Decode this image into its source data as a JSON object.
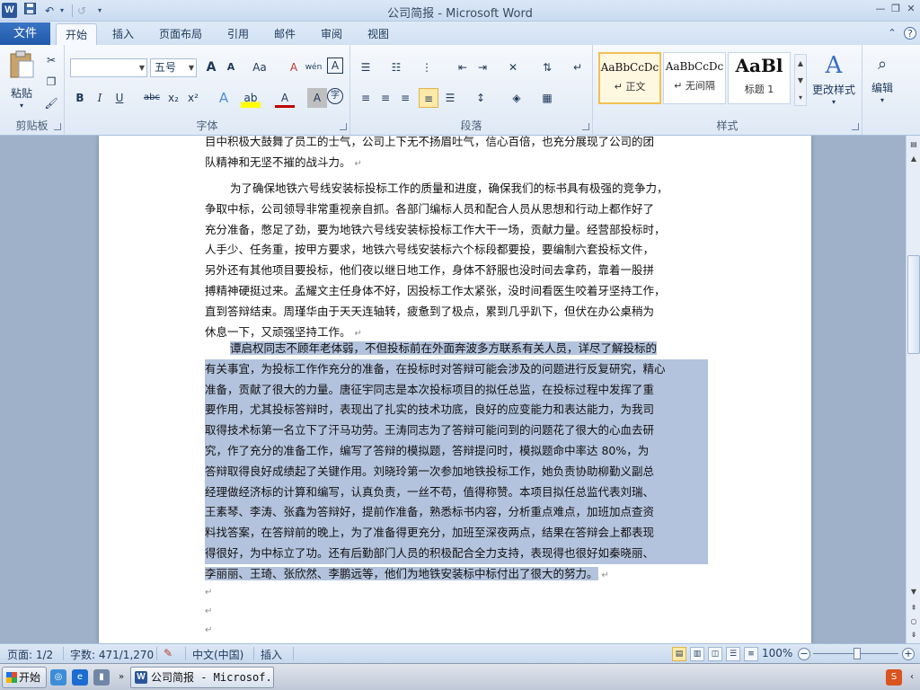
{
  "window": {
    "title": "公司简报 - Microsoft Word",
    "app_icon": "W"
  },
  "quick_access": {
    "items": [
      {
        "name": "save-icon",
        "glyph": "💾"
      },
      {
        "name": "undo-icon",
        "glyph": "↶"
      },
      {
        "name": "undo-dropdown-icon",
        "glyph": "▾"
      },
      {
        "name": "redo-icon",
        "glyph": "↺"
      },
      {
        "name": "customize-qa-icon",
        "glyph": "▾"
      }
    ]
  },
  "window_buttons": {
    "minimize": "—",
    "restore": "❐",
    "close": "✕"
  },
  "tabs": {
    "file": "文件",
    "items": [
      "开始",
      "插入",
      "页面布局",
      "引用",
      "邮件",
      "审阅",
      "视图"
    ],
    "active": "开始",
    "help_glyph": "?",
    "collapse_glyph": "⌃"
  },
  "ribbon": {
    "clipboard": {
      "label": "剪贴板",
      "paste": "粘贴",
      "paste_arrow": "▾"
    },
    "font": {
      "label": "字体",
      "font_name": "",
      "font_size": "五号",
      "bold": "B",
      "italic": "I",
      "underline": "U",
      "strike": "abc",
      "subscript": "x₂",
      "superscript": "x²",
      "grow": "A",
      "shrink": "A",
      "change_case": "Aa",
      "clear_format": "A",
      "phonetic": "wén",
      "char_border": "A",
      "text_effect": "A",
      "highlight": "ab",
      "font_color": "A",
      "char_shading": "A",
      "enclose": "字"
    },
    "paragraph": {
      "label": "段落"
    },
    "styles": {
      "label": "样式",
      "items": [
        {
          "sample": "AaBbCcDc",
          "name": "↵ 正文"
        },
        {
          "sample": "AaBbCcDc",
          "name": "↵ 无间隔"
        },
        {
          "sample": "AaBl",
          "name": "标题 1"
        }
      ],
      "change_styles": "更改样式"
    },
    "editing": {
      "label": "编辑"
    }
  },
  "document": {
    "paragraphs": [
      {
        "lines": [
          "目中积极大鼓舞了员工的士气，公司上下无不扬眉吐气，信心百倍，也充分展现了公司的团",
          "队精神和无坚不摧的战斗力。"
        ],
        "selected": false
      },
      {
        "lines": [
          "为了确保地铁六号线安装标投标工作的质量和进度，确保我们的标书具有极强的竞争力，",
          "争取中标，公司领导非常重视亲自抓。各部门编标人员和配合人员从思想和行动上都作好了",
          "充分准备，憋足了劲，要为地铁六号线安装标投标工作大干一场，贡献力量。经营部投标时，",
          "人手少、任务重，按甲方要求，地铁六号线安装标六个标段都要投，要编制六套投标文件，",
          "另外还有其他项目要投标，他们夜以继日地工作，身体不舒服也没时间去拿药，靠着一股拼",
          "搏精神硬挺过来。孟耀文主任身体不好，因投标工作太紧张，没时间看医生咬着牙坚持工作，",
          "直到答辩结束。周瑾华由于天天连轴转，疲惫到了极点，累到几乎趴下，但伏在办公桌稍为",
          "休息一下，又顽强坚持工作。"
        ],
        "selected": false
      },
      {
        "lines": [
          "谭启权同志不顾年老体弱，不但投标前在外面奔波多方联系有关人员，详尽了解投标的",
          "有关事宜，为投标工作作充分的准备，在投标时对答辩可能会涉及的问题进行反复研究，精心",
          "准备，贡献了很大的力量。唐征宇同志是本次投标项目的拟任总监，在投标过程中发挥了重",
          "要作用，尤其投标答辩时，表现出了扎实的技术功底，良好的应变能力和表达能力，为我司",
          "取得技术标第一名立下了汗马功劳。王涛同志为了答辩可能问到的问题花了很大的心血去研",
          "究，作了充分的准备工作，编写了答辩的模拟题，答辩提问时，模拟题命中率达 80%，为",
          "答辩取得良好成绩起了关键作用。刘晓玲第一次参加地铁投标工作，她负责协助柳勤义副总",
          "经理做经济标的计算和编写，认真负责，一丝不苟，值得称赞。本项目拟任总监代表刘瑞、",
          "王素琴、李涛、张鑫为答辩好，提前作准备，熟悉标书内容，分析重点难点，加班加点查资",
          "料找答案，在答辩前的晚上，为了准备得更充分，加班至深夜两点，结果在答辩会上都表现",
          "得很好，为中标立了功。还有后勤部门人员的积极配合全力支持，表现得也很好如秦晓丽、",
          "李丽丽、王琦、张欣然、李鹏远等，他们为地铁安装标中标付出了很大的努力。"
        ],
        "selected": true
      }
    ],
    "paragraph_mark": "↵"
  },
  "statusbar": {
    "page": "页面: 1/2",
    "words": "字数: 471/1,270",
    "language": "中文(中国)",
    "insert_mode": "插入",
    "zoom": "100%",
    "zoom_minus": "−",
    "zoom_plus": "+"
  },
  "taskbar": {
    "start": "开始",
    "chevron": "»",
    "task": "公司简报 - Microsof...",
    "task_icon": "W"
  }
}
